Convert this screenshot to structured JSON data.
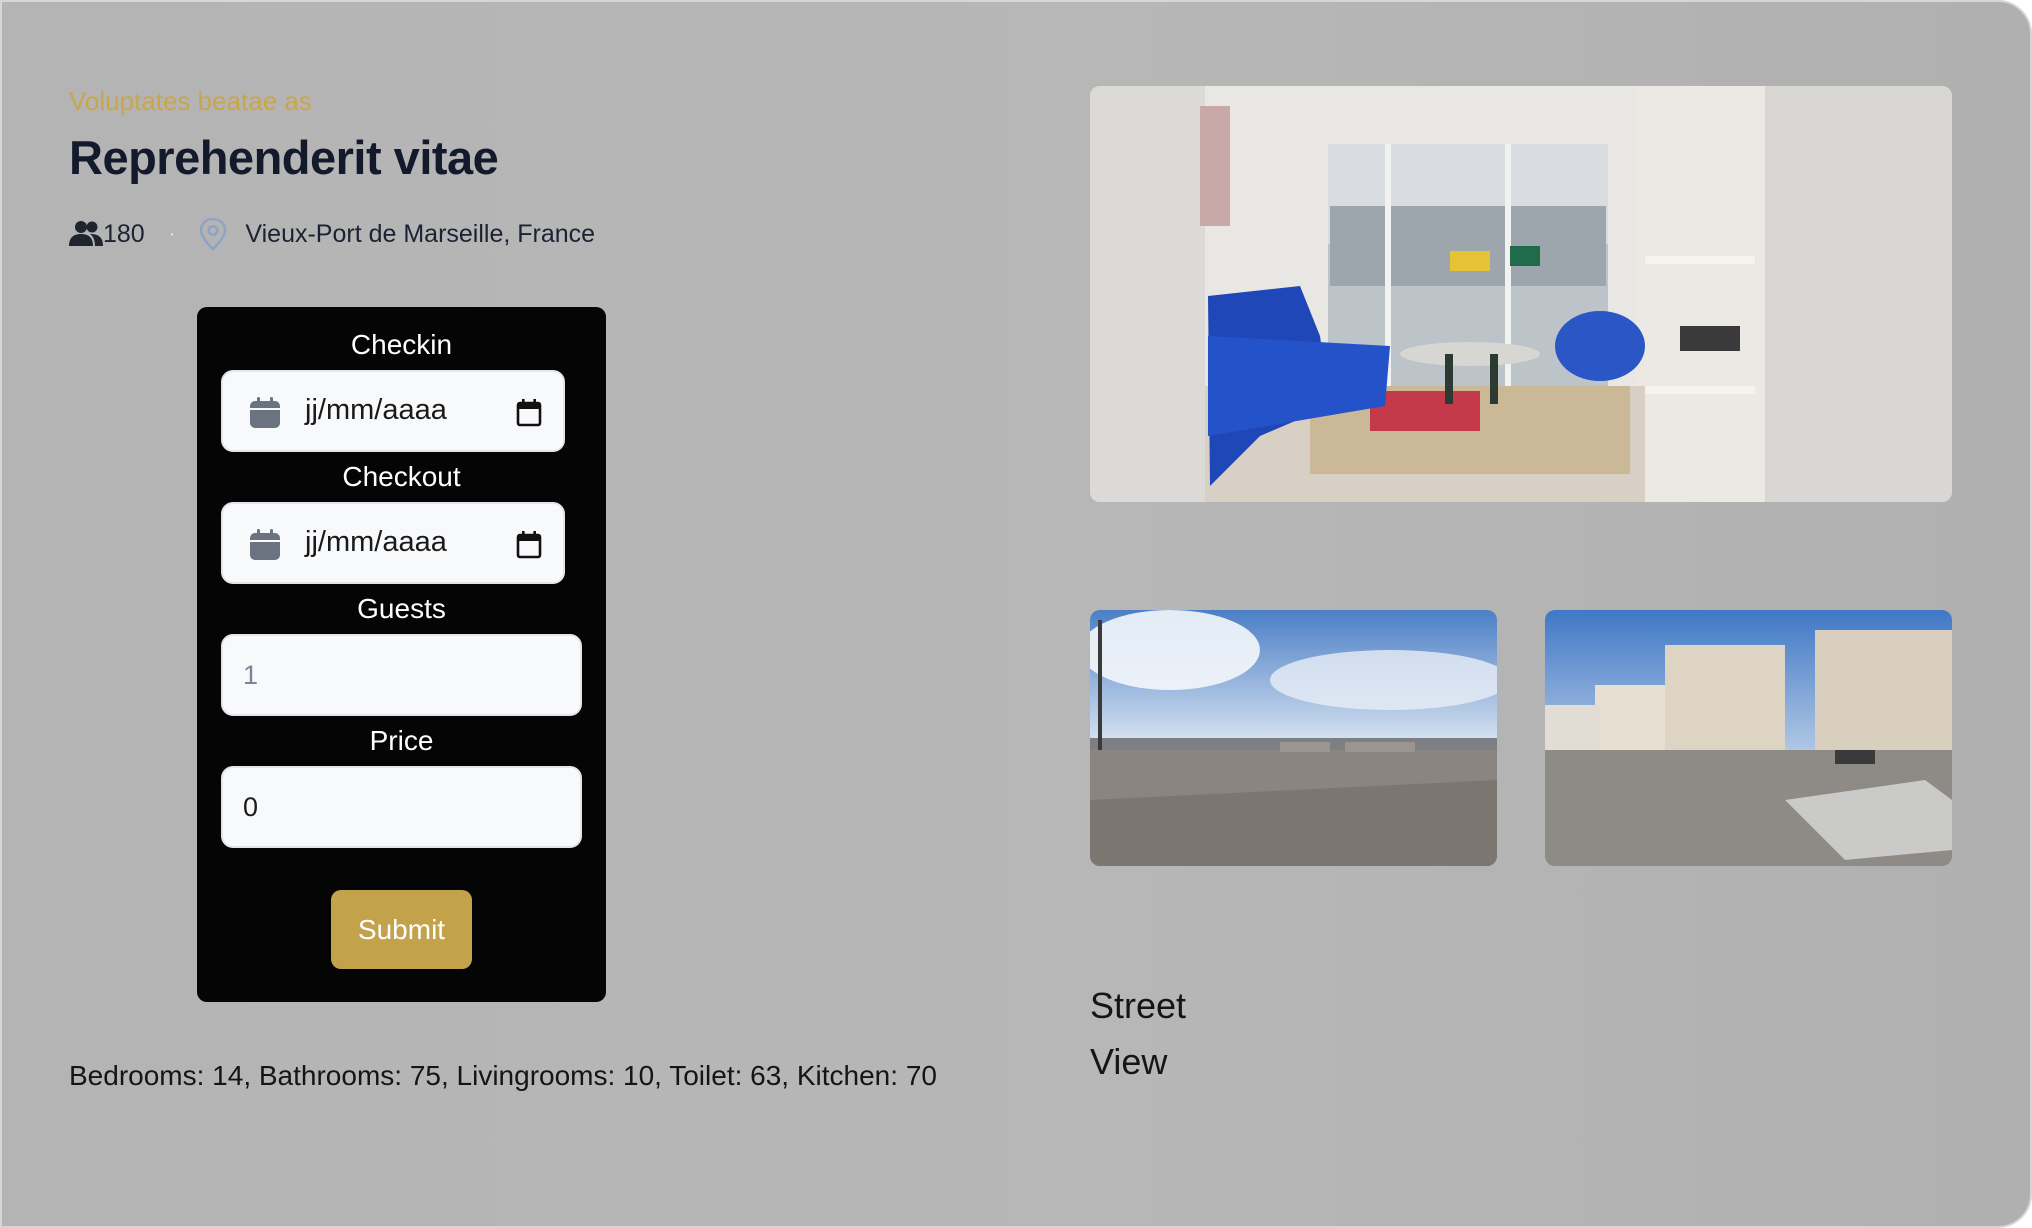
{
  "listing": {
    "subtitle": "Voluptates beatae as",
    "title": "Reprehenderit vitae",
    "guests_count": "180",
    "separator": "·",
    "location": "Vieux-Port de Marseille, France"
  },
  "booking_form": {
    "checkin_label": "Checkin",
    "checkin_value": "jj/mm/aaaa",
    "checkout_label": "Checkout",
    "checkout_value": "jj/mm/aaaa",
    "guests_label": "Guests",
    "guests_placeholder": "1",
    "price_label": "Price",
    "price_value": "0",
    "submit_label": "Submit"
  },
  "rooms_summary": "Bedrooms: 14, Bathrooms: 75, Livingrooms: 10, Toilet: 63, Kitchen: 70",
  "street_view_label": "Street View",
  "colors": {
    "accent": "#c3a24c",
    "subtitle": "#c9a64b",
    "title": "#121a2c",
    "form_bg": "#050505",
    "page_bg": "#b5b5b5",
    "pin_icon": "#8fa3c8"
  },
  "icons": [
    "users-icon",
    "map-pin-icon",
    "calendar-icon",
    "calendar-picker-icon"
  ]
}
